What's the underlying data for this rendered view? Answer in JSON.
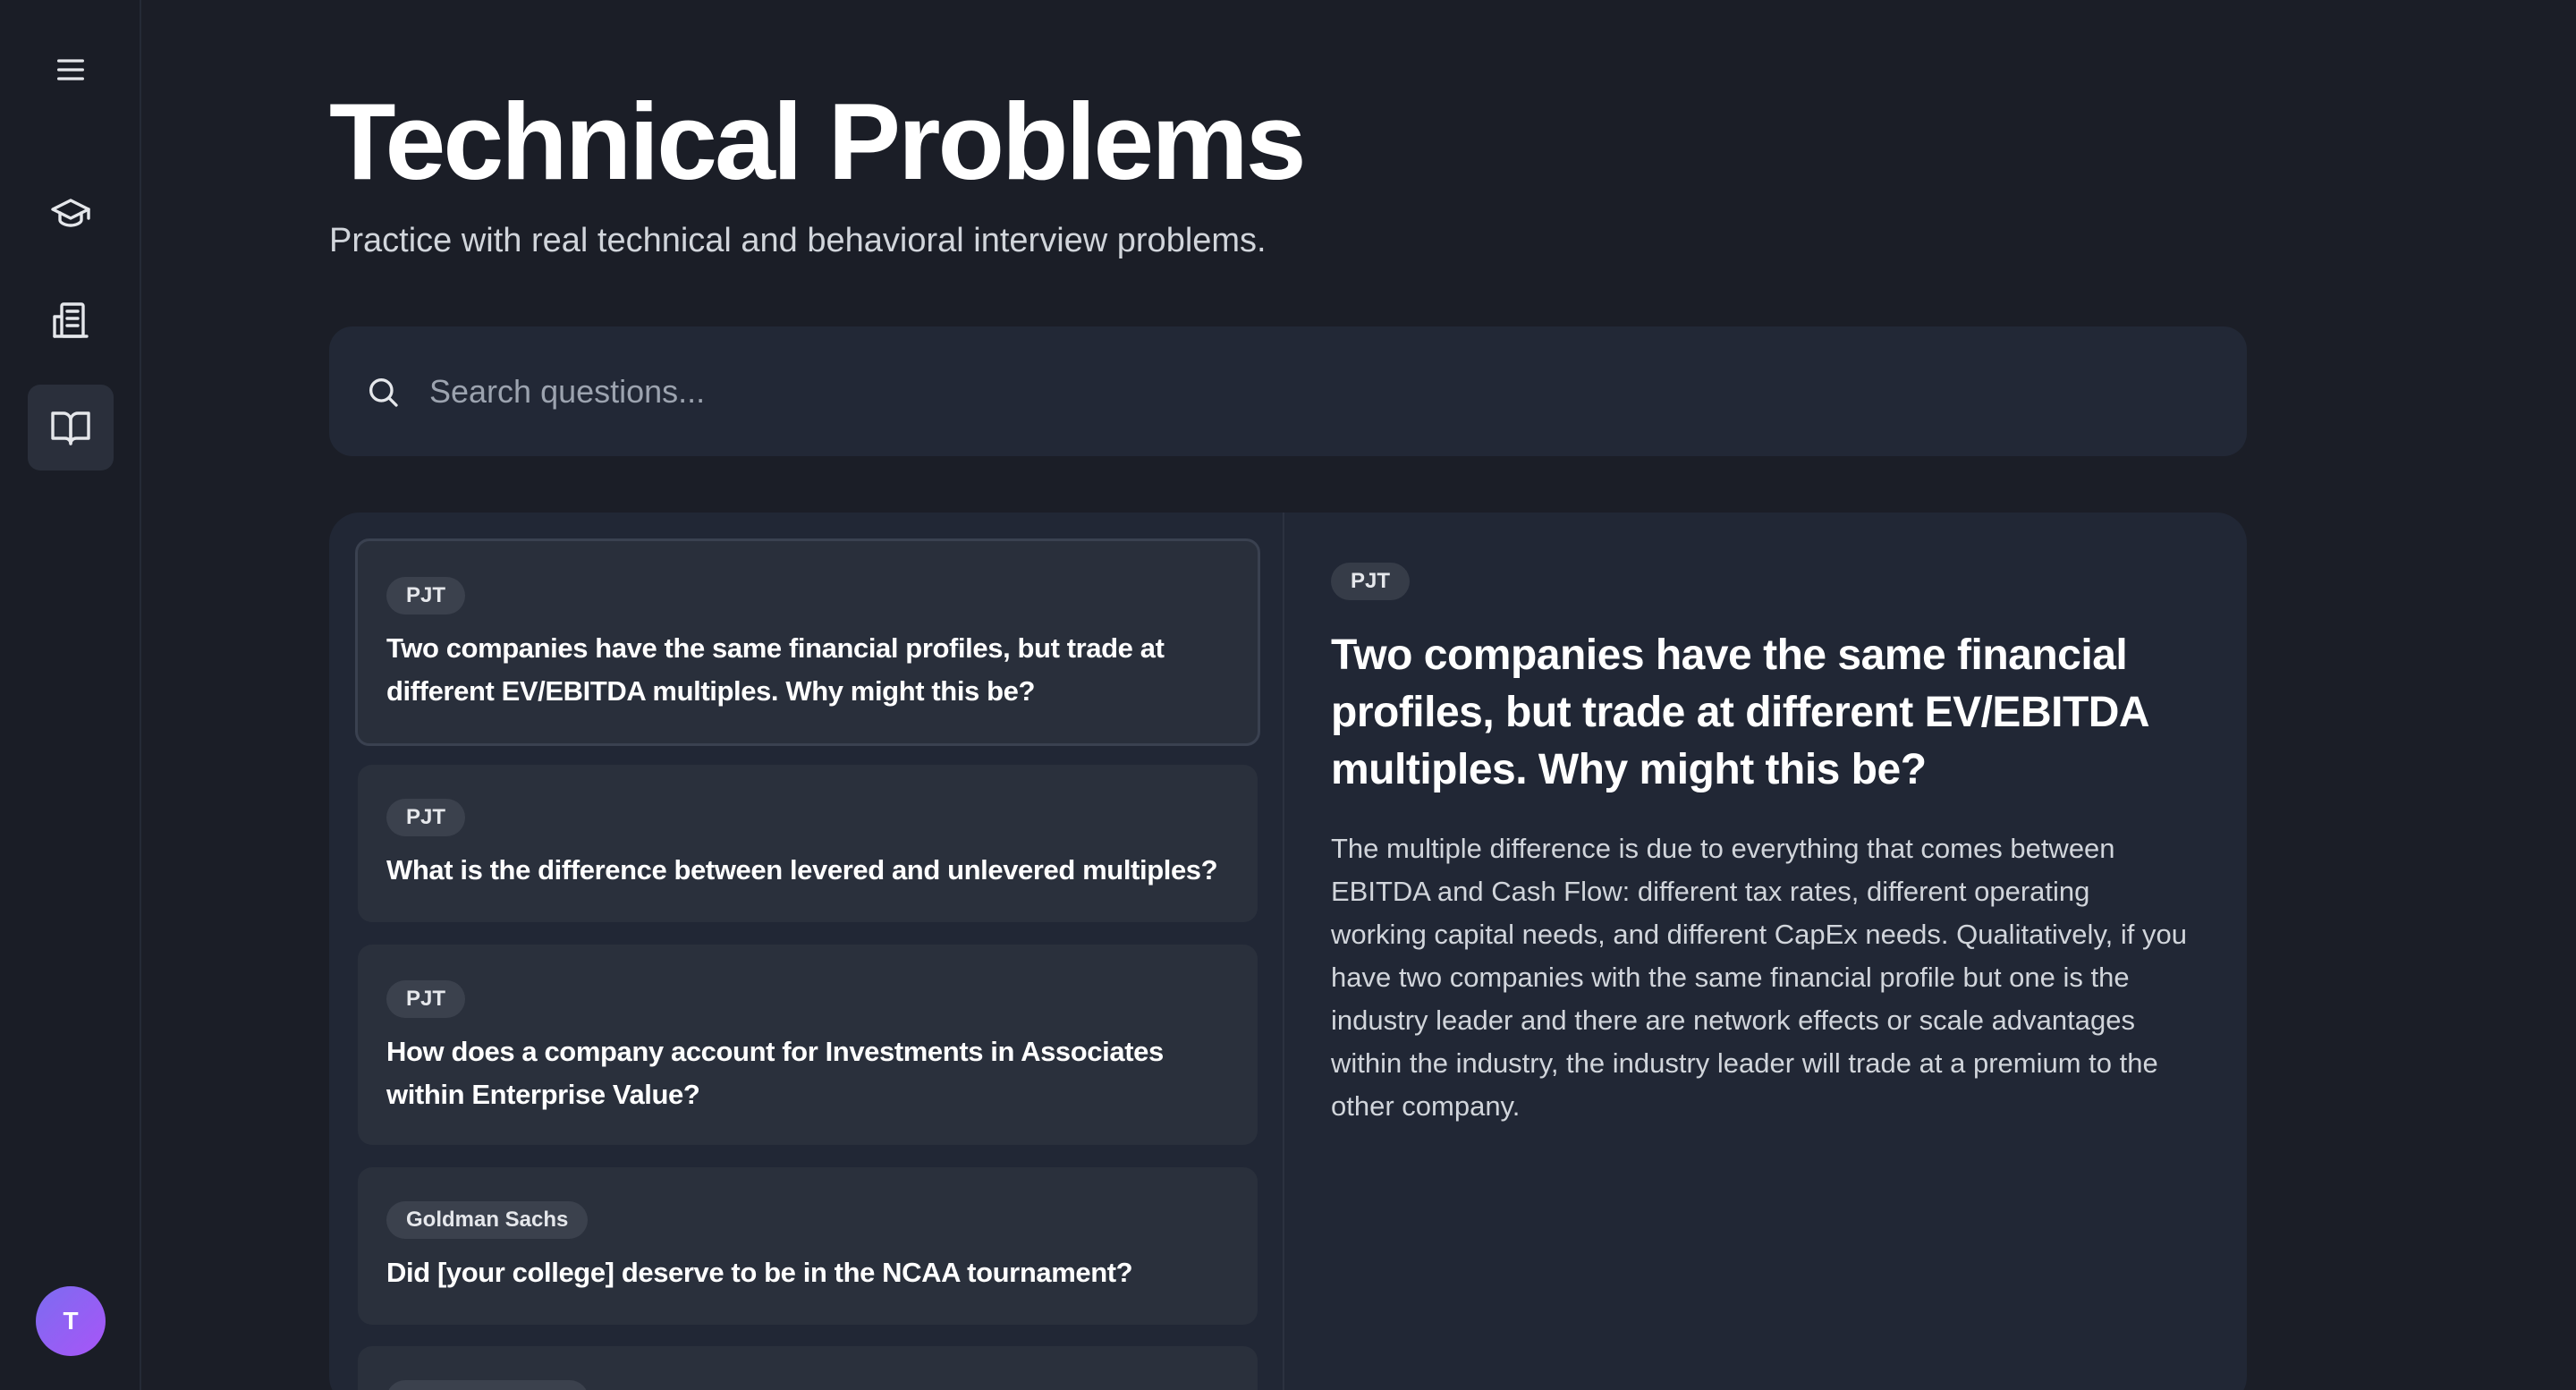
{
  "sidebar": {
    "items": [
      {
        "icon": "menu-icon"
      },
      {
        "icon": "graduation-cap-icon"
      },
      {
        "icon": "building-icon"
      },
      {
        "icon": "book-open-icon",
        "active": true
      }
    ],
    "avatar_initial": "T"
  },
  "header": {
    "title": "Technical Problems",
    "subtitle": "Practice with real technical and behavioral interview problems."
  },
  "search": {
    "placeholder": "Search questions...",
    "value": ""
  },
  "questions": [
    {
      "tag": "PJT",
      "text": "Two companies have the same financial profiles, but trade at different EV/EBITDA multiples. Why might this be?",
      "selected": true
    },
    {
      "tag": "PJT",
      "text": "What is the difference between levered and unlevered multiples?"
    },
    {
      "tag": "PJT",
      "text": "How does a company account for Investments in Associates within Enterprise Value?"
    },
    {
      "tag": "Goldman Sachs",
      "text": "Did [your college] deserve to be in the NCAA tournament?"
    }
  ],
  "detail": {
    "tag": "PJT",
    "title": "Two companies have the same financial profiles, but trade at different EV/EBITDA multiples. Why might this be?",
    "answer": "The multiple difference is due to everything that comes between EBITDA and Cash Flow: different tax rates, different operating working capital needs, and different CapEx needs. Qualitatively, if you have two companies with the same financial profile but one is the industry leader and there are network effects or scale advantages within the industry, the industry leader will trade at a premium to the other company."
  },
  "colors": {
    "background": "#1b1e27",
    "panel": "#212735",
    "card": "#2a303c",
    "avatar": "#8b5cf6"
  }
}
